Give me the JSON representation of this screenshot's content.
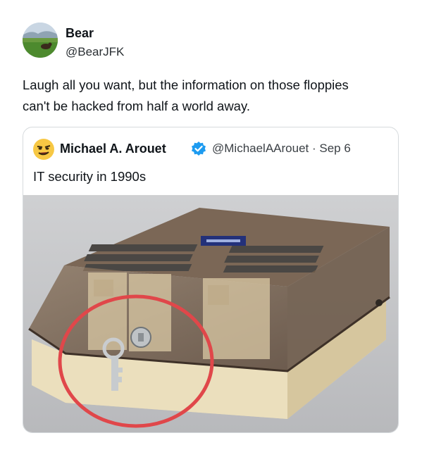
{
  "post": {
    "author_name": "Bear",
    "author_handle": "@BearJFK",
    "text_line1": "Laugh all you want, but the information on those floppies",
    "text_line2": "can't be hacked from half a world away."
  },
  "quote": {
    "author_name": "Michael A. Arouet",
    "author_handle_date": "@MichaelAArouet · Sep 6",
    "text": "IT security in 1990s",
    "badge_color": "#1d9bf0"
  },
  "image": {
    "alt": "Smoked plastic floppy disk storage box with a key in its lock, lock circled in red",
    "highlight_color": "#e0474a"
  }
}
